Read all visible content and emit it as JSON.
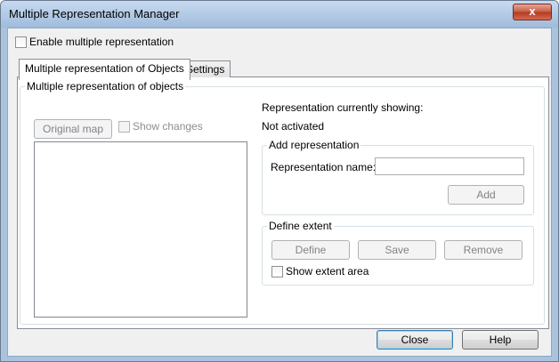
{
  "window": {
    "title": "Multiple Representation Manager",
    "close_glyph": "x"
  },
  "enable_checkbox": {
    "label": "Enable multiple representation",
    "checked": false
  },
  "tabs": [
    {
      "label": "Multiple representation of Objects",
      "active": true
    },
    {
      "label": "Settings",
      "active": false
    }
  ],
  "objects_group": {
    "title": "Multiple representation of objects",
    "original_map_button": "Original map",
    "show_changes_label": "Show changes"
  },
  "status": {
    "heading": "Representation currently showing:",
    "value": "Not activated"
  },
  "add_representation": {
    "title": "Add representation",
    "name_label": "Representation name:",
    "name_value": "",
    "add_button": "Add"
  },
  "define_extent": {
    "title": "Define extent",
    "define_button": "Define",
    "save_button": "Save",
    "remove_button": "Remove",
    "show_extent_label": "Show extent area",
    "show_extent_checked": false
  },
  "footer": {
    "close_button": "Close",
    "help_button": "Help"
  }
}
